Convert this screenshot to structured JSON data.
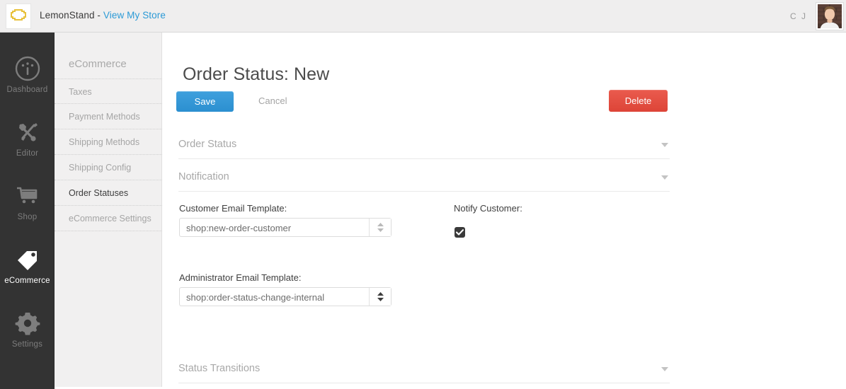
{
  "topbar": {
    "logo_icon": "lemonstand-logo-icon",
    "brand_name": "LemonStand -",
    "store_link": "View My Store",
    "user_initials": "C J",
    "avatar_alt": "user-avatar"
  },
  "primary_nav": {
    "items": [
      {
        "label": "Dashboard",
        "icon": "gauge-icon",
        "active": false
      },
      {
        "label": "Editor",
        "icon": "tools-icon",
        "active": false
      },
      {
        "label": "Shop",
        "icon": "cart-icon",
        "active": false
      },
      {
        "label": "eCommerce",
        "icon": "tag-icon",
        "active": true
      },
      {
        "label": "Settings",
        "icon": "gear-icon",
        "active": false
      }
    ]
  },
  "secondary_nav": {
    "title": "eCommerce",
    "items": [
      {
        "label": "Taxes",
        "active": false
      },
      {
        "label": "Payment Methods",
        "active": false
      },
      {
        "label": "Shipping Methods",
        "active": false
      },
      {
        "label": "Shipping Config",
        "active": false
      },
      {
        "label": "Order Statuses",
        "active": true
      },
      {
        "label": "eCommerce Settings",
        "active": false
      }
    ]
  },
  "main": {
    "page_title": "Order Status: New",
    "toolbar": {
      "save_label": "Save",
      "cancel_label": "Cancel",
      "delete_label": "Delete"
    },
    "sections": [
      {
        "title": "Order Status",
        "collapsed": true
      },
      {
        "title": "Notification",
        "collapsed": false
      },
      {
        "title": "Status Transitions",
        "collapsed": true
      }
    ],
    "fields": {
      "customer_email_template": {
        "label": "Customer Email Template:",
        "value": "shop:new-order-customer"
      },
      "administrator_email_template": {
        "label": "Administrator Email Template:",
        "value": "shop:order-status-change-internal"
      },
      "notify_customer": {
        "label": "Notify Customer:",
        "checked": true
      }
    }
  },
  "colors": {
    "accent_blue": "#2b9ad6",
    "save_blue": "#3498db",
    "delete_red": "#e04437",
    "sidebar_dark": "#333333",
    "sidebar_light": "#f1f0f0",
    "logo_yellow": "#e8c13c"
  }
}
